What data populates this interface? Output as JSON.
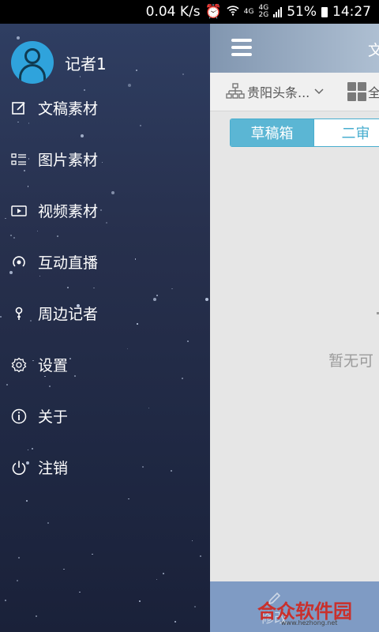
{
  "status_bar": {
    "speed": "0.04 K/s",
    "net_4g_a": "4G",
    "net_4g_b": "4G",
    "net_2g": "2G",
    "battery": "51%",
    "time": "14:27"
  },
  "drawer": {
    "user_name": "记者1",
    "items": [
      {
        "label": "文稿素材",
        "icon": "edit-icon"
      },
      {
        "label": "图片素材",
        "icon": "list-icon"
      },
      {
        "label": "视频素材",
        "icon": "video-icon"
      },
      {
        "label": "互动直播",
        "icon": "broadcast-icon"
      },
      {
        "label": "周边记者",
        "icon": "location-pin-icon"
      },
      {
        "label": "设置",
        "icon": "gear-icon"
      },
      {
        "label": "关于",
        "icon": "info-icon"
      },
      {
        "label": "注销",
        "icon": "power-icon"
      }
    ]
  },
  "main": {
    "title": "文",
    "filter_left": "贵阳头条...",
    "filter_right": "全",
    "tabs": [
      "草稿箱",
      "二审",
      ""
    ],
    "active_tab": 0,
    "empty_text": "暂无可",
    "edit_label": "修改"
  },
  "watermark": {
    "text": "合众软件园",
    "url": "www.hezhong.net"
  },
  "colors": {
    "accent": "#5bb6d4",
    "avatar": "#2fa3dc",
    "drawer_bg": "#27304d",
    "bottom_bar": "#7f9bc4",
    "watermark": "#c9302c"
  }
}
